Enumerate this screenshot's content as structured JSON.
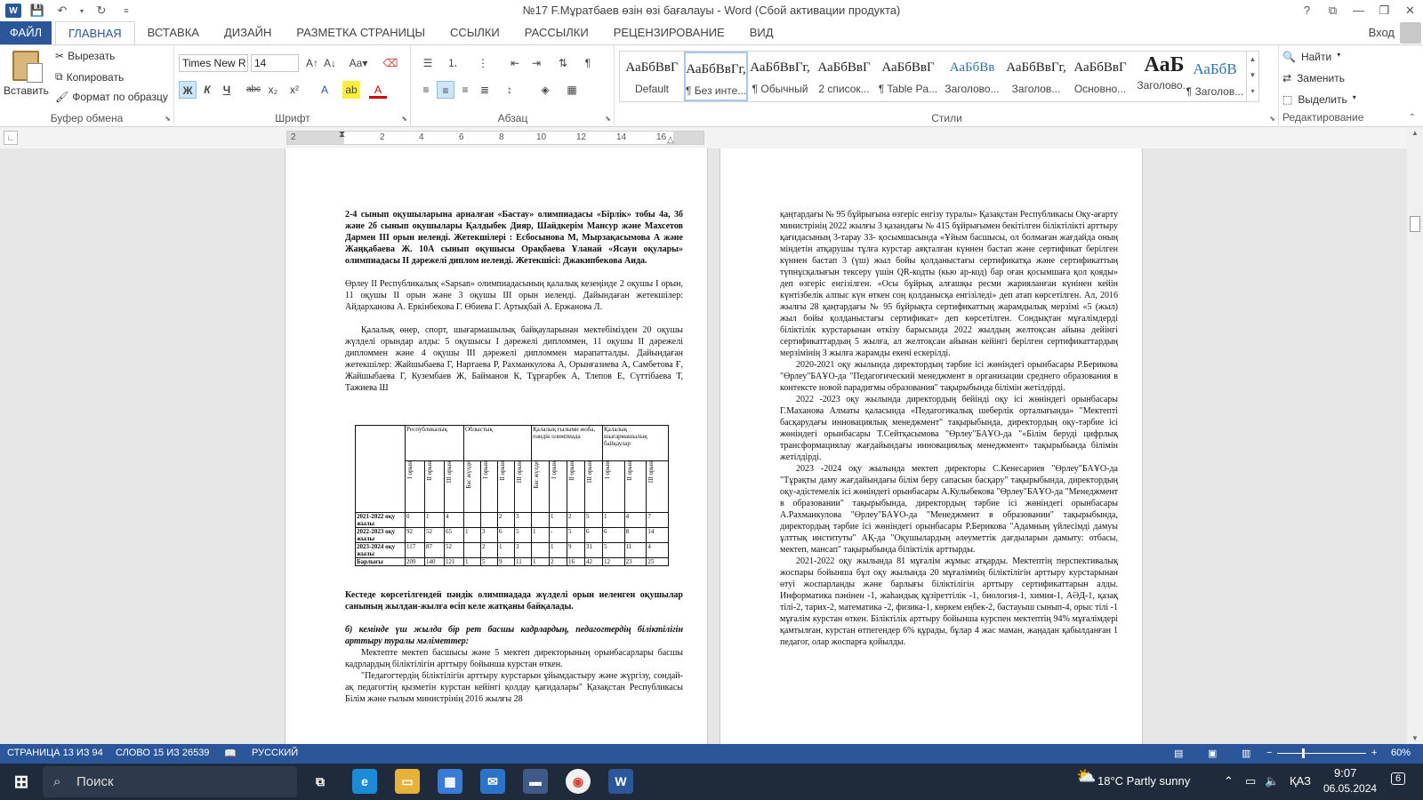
{
  "titlebar": {
    "title": "№17 F.Мұратбаев өзін өзі бағалауы - Word (Сбой активации продукта)",
    "word_letter": "W",
    "controls": [
      "?",
      "⧉",
      "—",
      "❐",
      "✕"
    ]
  },
  "tabs": {
    "file": "ФАЙЛ",
    "items": [
      "ГЛАВНАЯ",
      "ВСТАВКА",
      "ДИЗАЙН",
      "РАЗМЕТКА СТРАНИЦЫ",
      "ССЫЛКИ",
      "РАССЫЛКИ",
      "РЕЦЕНЗИРОВАНИЕ",
      "ВИД"
    ],
    "signin": "Вход"
  },
  "ribbon": {
    "clipboard": {
      "paste": "Вставить",
      "cut": "Вырезать",
      "copy": "Копировать",
      "format_painter": "Формат по образцу",
      "label": "Буфер обмена"
    },
    "font": {
      "name": "Times New R",
      "size": "14",
      "bold": "Ж",
      "italic": "К",
      "underline": "Ч",
      "strike": "abc",
      "sub": "x₂",
      "sup": "x²",
      "label": "Шрифт"
    },
    "paragraph": {
      "label": "Абзац"
    },
    "styles": {
      "label": "Стили",
      "items": [
        {
          "preview": "АаБбВвГ",
          "name": "Default"
        },
        {
          "preview": "АаБбВвГг,",
          "name": "¶ Без инте..."
        },
        {
          "preview": "АаБбВвГг,",
          "name": "¶ Обычный"
        },
        {
          "preview": "АаБбВвГ",
          "name": "2 список..."
        },
        {
          "preview": "АаБбВвГ",
          "name": "¶ Table Pa..."
        },
        {
          "preview": "АаБбВв",
          "name": "Заголово..."
        },
        {
          "preview": "АаБбВвГг,",
          "name": "Заголов..."
        },
        {
          "preview": "АаБбВвГ",
          "name": "Основно..."
        },
        {
          "preview": "АаБ",
          "name": "Заголово..."
        },
        {
          "preview": "АаБбВ",
          "name": "¶ Заголов..."
        }
      ]
    },
    "editing": {
      "find": "Найти",
      "replace": "Заменить",
      "select": "Выделить",
      "label": "Редактирование"
    }
  },
  "ruler": {
    "numbers": [
      "2",
      "2",
      "4",
      "6",
      "8",
      "10",
      "12",
      "14",
      "16"
    ]
  },
  "page_left": {
    "p1": "2-4 сынып оқушыларына арналған «Бастау» олимпиадасы «Бірлік» тобы 4а, 3б және 2б сынып оқушылары Қалдыбек Дияр, Шайдкерім Мансур және Махсетов Дармен ІІІ орын иеленді. Жетекшілері : Есбосынова М, Мырзақасымова А және Жаңқабаева Ж. 10А сынып оқушысы Орақбаева Ұланай «Ясауи оқулары» олимпиадасы ІІ дәрежелі диплом иеленді. Жетекшісі: Джакипбекова Аида.",
    "p2": "Өрлеу ІІ Республикалық «Sapsan» олимпиадасының қалалық кезеңінде 2 оқушы І орын, 11 оқушы ІІ орын және 3 оқушы ІІІ орын иеленді. Дайындаған жетекшілер: Айдарханова А. Еркінбекова Г. Өбиева Г. Артықбай А. Ержанова Л.",
    "p3": "Қалалық өнер, спорт, шығармашылық байқауларынан мектебімізден 20 оқушы жүлделі орындар алды: 5 оқушысы І дәрежелі дипломмен, 11 оқушы ІІ дәрежелі дипломмен және 4 оқушы ІІІ дәрежелі дипломмен марапатталды. Дайындаған жетекшілер: Жайшыбаева Г, Нартаева Р, Рахманкулова А, Орынғазиева А, Самбетова Ғ, Жайшыбаева Г, Кузембаев Ж, Байманов К, Тұрғарбек А, Тлепов Е, Сүттібаева Т, Тажиева Ш",
    "table": {
      "groups": [
        "Республикалық",
        "Облыстық",
        "Қалалық ғылыми жоба, пәндік олимпиада",
        "Қалалық шығармашылық байқаулар"
      ],
      "subheaders": [
        "І орын",
        "ІІ орын",
        "ІІІ орын",
        "Бас жүлде",
        "І орын",
        "ІІ орын",
        "ІІІ орын",
        "Бас жүлде",
        "І орын",
        "ІІ орын",
        "ІІІ орын",
        "І орын",
        "ІІ орын",
        "ІІІ орын"
      ],
      "rows": [
        {
          "label": "2021-2022 оқу жылы",
          "cells": [
            "0",
            "1",
            "4",
            "",
            "",
            "2",
            "3",
            "",
            "1",
            "2",
            "5",
            "1",
            "4",
            "7"
          ]
        },
        {
          "label": "2022-2023 оқу жылы",
          "cells": [
            "92",
            "52",
            "65",
            "1",
            "3",
            "6",
            "5",
            "1",
            "-",
            "5",
            "6",
            "6",
            "8",
            "14"
          ]
        },
        {
          "label": "2023-2024 оқу жылы",
          "cells": [
            "117",
            "87",
            "52",
            "",
            "2",
            "1",
            "3",
            "",
            "1",
            "9",
            "31",
            "5",
            "11",
            "4"
          ]
        },
        {
          "label": "Барлығы",
          "cells": [
            "209",
            "140",
            "121",
            "1",
            "5",
            "9",
            "11",
            "1",
            "2",
            "16",
            "42",
            "12",
            "23",
            "25"
          ]
        }
      ]
    },
    "p4": "Кестеде көрсетілгендей пәндік олимпиадада жүлделі орын иеленген оқушылар санының жылдан-жылға өсіп келе жатқаны байқалады.",
    "p5": "б) кемінде үш жылда бір рет басшы кадрлардың, педагогтердің біліктілігін арттыру туралы мәліметтер:",
    "p6": "Мектепте мектеп басшысы және 5 мектеп директорының орынбасарлары басшы кадрлардың біліктілігін арттыру бойынша курстан өткен.",
    "p7": "\"Педагогтердің біліктілігін арттыру курстарын ұйымдастыру және жүргізу, сондай-ақ педагогтің қызметін курстан кейінгі қолдау қағидалары\" Қазақстан Республикасы Білім және ғылым министрінің 2016 жылғы 28"
  },
  "page_right": {
    "p1": "қаңтардағы № 95 бұйрығына өзгеріс енгізу туралы» Қазақстан Республикасы Оқу-ағарту министрінің 2022 жылғы 3 қазандағы № 415 бұйрығымен бекітілген біліктілікті арттыру қағидасының 3-тарау 33- қосымшасында «Ұйым басшысы, ол болмаған жағдайда оның міндетін атқарушы тұлға курстар аяқталған күннен бастап және сертификат берілген күннен бастап 3 (үш) жыл бойы қолданыстағы сертификатқа және сертификаттың түпнұсқалығын тексеру үшін QR-кодты (кью ар-код) бар оған қосымшаға қол қояды» деп өзгеріс енгізілген. «Осы бұйрық алғашқы ресми жарияланған күнінен кейін күнтізбелік алпыс күн өткен соң қолданысқа енгізіледі» деп атап көрсетілген. Ал, 2016 жылғы 28 қаңтардағы № 95 бұйрықта сертификаттың жарамдылық мерзімі «5 (жыл) жыл бойы қолданыстағы сертификат» деп көрсетілген. Сондықтан мұғалімдерді біліктілік курстарынан өткізу барысында 2022 жылдың желтоқсан айына дейінгі сертификаттардың 5 жылға, ал желтоқсан айынан кейінгі берілген сертификаттардың мерзімінің 3 жылға жарамды екені ескерілді.",
    "p2": "2020-2021 оқу жылында директордың тәрбие ісі жөніндегі орынбасары Р.Берикова \"Өрлеу\"БАҰО-да \"Педагогический менеджмент в организации среднего образования в контексте новой парадигмы образования\" тақырыбында білімін жетілдірді.",
    "p3": "2022 -2023 оқу жылында директордың бейінді оқу ісі жөніндегі орынбасары Г.Маханова Алматы қаласында «Педагогикалық шеберлік орталығында» \"Мектепті басқарудағы инновациялық менеджмент\" тақырыбында, директордың оқу-тәрбие ісі жөніндегі орынбасары Т.Сейтқасымова \"Өрлеу\"БАҰО-да \"«Білім беруді цифрлық трансформациялау жағдайындағы инновациялық менеджмент» тақырыбында білімін жетілдірді.",
    "p4": "2023 -2024 оқу жылында мектеп директоры С.Кенесариев \"Өрлеу\"БАҰО-да \"Тұрақты даму жағдайындағы білім беру сапасын басқару\" тақырыбында, директордың оқу-әдістемелік ісі жөніндегі орынбасары А.Кулыбекова \"Өрлеу\"БАҰО-да \"Менеджмент в образовании\" тақырыбында, директордың тәрбие ісі жөніндегі орынбасары А.Рахманкулова \"Өрлеу\"БАҰО-да \"Менеджмент в образовании\" тақырыбында, директордың тәрбие ісі жөніндегі орынбасары Р.Берикова \"Адамның үйлесімді дамуы ұлттық институты\" АҚ-да \"Оқушылардың әлеуметтік дағдыларын дамыту: отбасы, мектеп, мансап\" тақырыбында біліктілік арттырды.",
    "p5": "2021-2022 оқу жылында 81 мұғалім жұмыс атқарды. Мектептің перспективалық жоспары бойынша бұл оқу жылында 20 мұғалімнің біліктілігін арттыру курстарынан өтуі жоспарланды және барлығы біліктілігін арттыру сертификаттарын алды. Информатика пәнінен -1, жаһандық құзіреттілік -1, биология-1, химия-1, АӘД-1, қазақ тілі-2, тарих-2, математика -2, физика-1, көркем еңбек-2, бастауыш сынып-4, орыс тілі -1 мұғалім курстан өткен. Біліктілік арттыру бойынша курспен мектептің 94% мұғалімдері қамтылған, курстан өтпегендер 6% құрады, бұлар 4 жас маман, жаңадан қабылданған 1 педагог, олар жоспарға қойылды."
  },
  "statusbar": {
    "page": "СТРАНИЦА 13 ИЗ 94",
    "words": "СЛОВО 15 ИЗ 26539",
    "lang": "РУССКИЙ",
    "zoom": "60%",
    "zoom_value": 0.6
  },
  "taskbar": {
    "search": "Поиск",
    "weather": "18°C Partly sunny",
    "lang": "ҚАЗ",
    "time": "9:07",
    "date": "06.05.2024",
    "notif": "6"
  },
  "colors": {
    "accent": "#2b579a",
    "taskbar": "#1f2a3a"
  }
}
